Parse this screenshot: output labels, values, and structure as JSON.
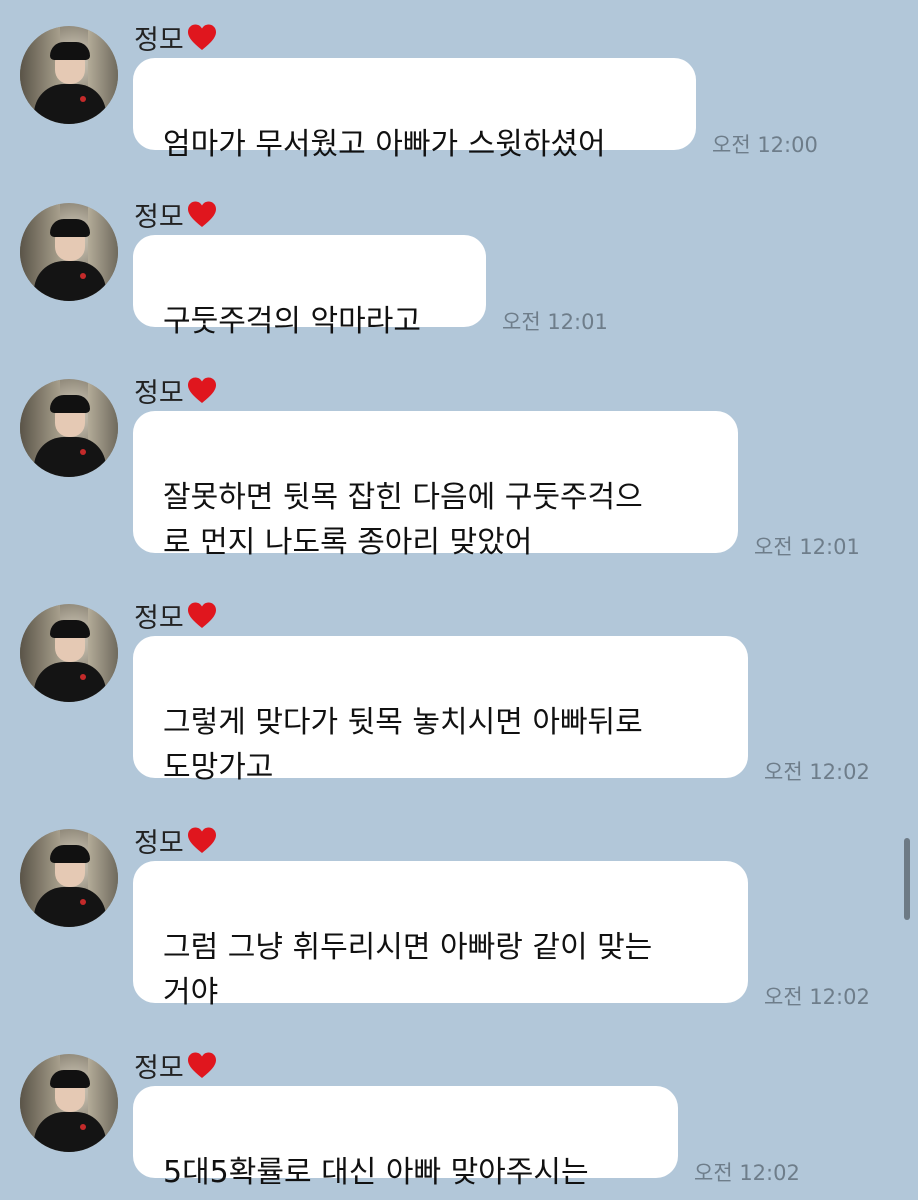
{
  "messages": [
    {
      "sender": "정모",
      "text": "엄마가 무서웠고 아빠가 스윗하셨어",
      "time": "오전 12:00"
    },
    {
      "sender": "정모",
      "text": "구둣주걱의 악마라고",
      "time": "오전 12:01"
    },
    {
      "sender": "정모",
      "text": "잘못하면 뒷목 잡힌 다음에 구둣주걱으\n로 먼지 나도록 종아리 맞았어",
      "time": "오전 12:01"
    },
    {
      "sender": "정모",
      "text": "그렇게 맞다가 뒷목 놓치시면 아빠뒤로\n도망가고",
      "time": "오전 12:02"
    },
    {
      "sender": "정모",
      "text": "그럼 그냥 휘두리시면 아빠랑 같이 맞는\n거야",
      "time": "오전 12:02"
    },
    {
      "sender": "정모",
      "text": "5대5확률로 대신 아빠 맞아주시는",
      "time": "오전 12:02"
    }
  ],
  "colors": {
    "background": "#b2c7d9",
    "bubble": "#ffffff",
    "heart": "#e0161e",
    "timestamp": "#6e7d8a"
  },
  "icons": {
    "heart": "heart-icon"
  }
}
